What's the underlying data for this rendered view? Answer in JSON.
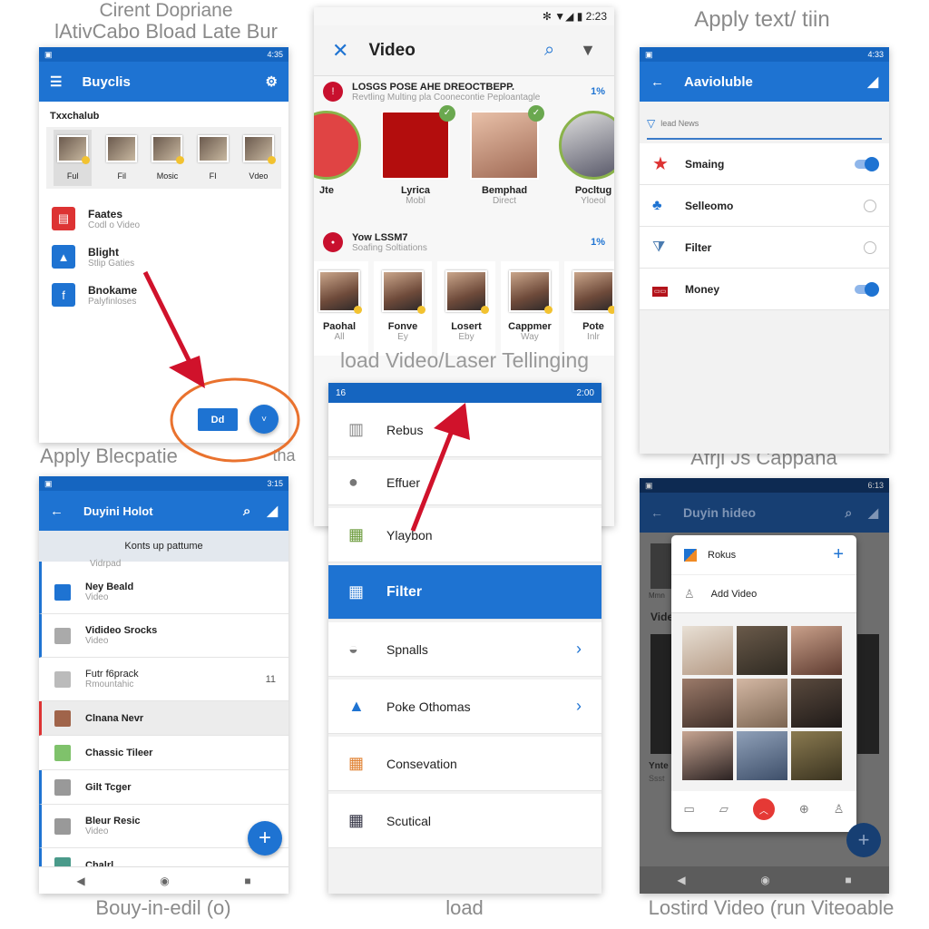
{
  "captions": {
    "top_left_1": "Cirent Dopriane",
    "top_left_2": "lAtivCabo Bload Late Bur",
    "top_right": "Apply text/ tiin",
    "mid_left": "Apply Blecpatie",
    "mid_left_2": "tha",
    "mid_right": "Afrji Js Cappana",
    "overlay_center": "load Video/Laser Tellinging",
    "bottom_left": "Bouy-in-edil (o)",
    "bottom_center": "load",
    "bottom_right": "Lostird Video (run Viteoable"
  },
  "screen1": {
    "time": "4:35",
    "title": "Buyclis",
    "section": "Txxchalub",
    "thumbs": [
      {
        "label": "Ful"
      },
      {
        "label": "Fil"
      },
      {
        "label": "Mosic"
      },
      {
        "label": "FI"
      },
      {
        "label": "Vdeo"
      }
    ],
    "items": [
      {
        "title": "Faates",
        "subtitle": "Codl o Video"
      },
      {
        "title": "Blight",
        "subtitle": "Stlip Gaties"
      },
      {
        "title": "Bnokame",
        "subtitle": "Palyfinloses"
      }
    ],
    "button_label": "Dd",
    "fab_label": "˅"
  },
  "screen2": {
    "time": "2:23",
    "title": "Video",
    "section1": {
      "title": "LOSGS POSE AHE DREOCTBEPP.",
      "subtitle": "Revtling Multing pla Coonecontie Peploantagle",
      "percent": "1%"
    },
    "circles": [
      {
        "name": "Jte",
        "sub": ""
      },
      {
        "name": "Lyrica",
        "sub": "Mobl"
      },
      {
        "name": "Bemphad",
        "sub": "Direct"
      },
      {
        "name": "Pocltug",
        "sub": "Yloeol"
      }
    ],
    "section2": {
      "title": "Yow LSSM7",
      "subtitle": "Soafing Soltiations",
      "percent": "1%"
    },
    "people": [
      {
        "name": "Paohal",
        "sub": "All"
      },
      {
        "name": "Fonve",
        "sub": "Ey"
      },
      {
        "name": "Losert",
        "sub": "Eby"
      },
      {
        "name": "Cappmer",
        "sub": "Way"
      },
      {
        "name": "Pote",
        "sub": "Inlr"
      }
    ]
  },
  "screen3": {
    "time": "4:33",
    "title": "Aavioluble",
    "search_placeholder": "lead News",
    "rows": [
      {
        "label": "Smaing",
        "control": "toggle",
        "on": true
      },
      {
        "label": "Selleomo",
        "control": "radio",
        "on": false
      },
      {
        "label": "Filter",
        "control": "radio",
        "on": false
      },
      {
        "label": "Money",
        "control": "toggle",
        "on": true
      }
    ]
  },
  "screen4": {
    "time": "3:15",
    "title": "Duyini Holot",
    "banner": "Konts up pattume",
    "partial_top": "Vidrpad",
    "items": [
      {
        "title": "Ney Beald",
        "subtitle": "Video"
      },
      {
        "title": "Vidideo Srocks",
        "subtitle": "Video"
      },
      {
        "title": "Futr f6prack",
        "subtitle": "Rmountahic",
        "count": "11"
      },
      {
        "title": "Clnana Nevr",
        "subtitle": ""
      },
      {
        "title": "Chassic Tileer",
        "subtitle": ""
      },
      {
        "title": "Gilt Tcger",
        "subtitle": ""
      },
      {
        "title": "Bleur Resic",
        "subtitle": "Video"
      },
      {
        "title": "Chalrl",
        "subtitle": ""
      }
    ],
    "fab_label": "+"
  },
  "screen5": {
    "time_left": "16",
    "time": "2:00",
    "items": [
      {
        "label": "Rebus",
        "chevron": false
      },
      {
        "label": "Effuer",
        "chevron": false
      },
      {
        "label": "Ylaybon",
        "chevron": false
      },
      {
        "label": "Filter",
        "chevron": false,
        "selected": true
      },
      {
        "label": "Spnalls",
        "chevron": true
      },
      {
        "label": "Poke Othomas",
        "chevron": true
      },
      {
        "label": "Consevation",
        "chevron": false
      },
      {
        "label": "Scutical",
        "chevron": false
      }
    ]
  },
  "screen6": {
    "time": "6:13",
    "title": "Duyin hideo",
    "bg_label_1": "Mmn",
    "bg_label_2": "Vide",
    "bg_label_3": "Ynte",
    "bg_label_4": "Ssst",
    "dialog": {
      "header": "Rokus",
      "add_label": "Add Video",
      "plus": "+"
    },
    "fab_label": "+"
  },
  "colors": {
    "primary": "#1e73d2",
    "status": "#1565c0",
    "accent_red": "#d0122b",
    "annotation_orange": "#e9722e"
  }
}
